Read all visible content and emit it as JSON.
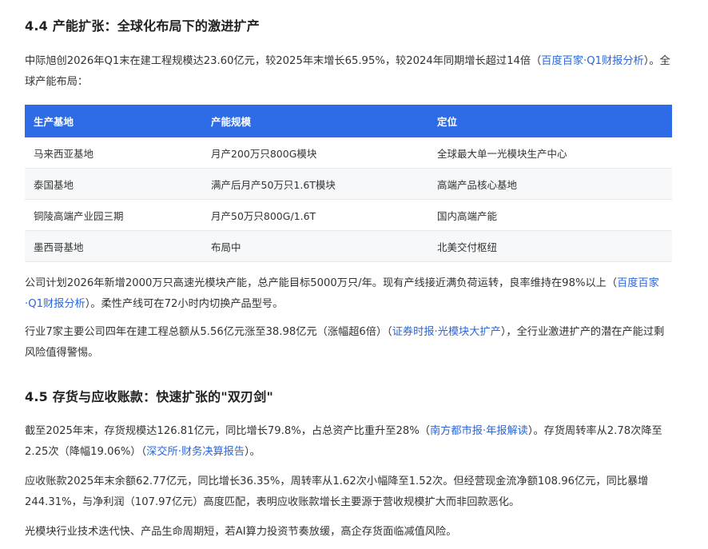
{
  "section_4_4": {
    "heading": "4.4 产能扩张：全球化布局下的激进扩产",
    "intro_text": "中际旭创2026年Q1末在建工程规模达23.60亿元，较2025年末增长65.95%，较2024年同期增长超过14倍（",
    "intro_cite": "百度百家·Q1财报分析",
    "intro_tail": "）。全球产能布局：",
    "table": {
      "headers": [
        "生产基地",
        "产能规模",
        "定位"
      ],
      "rows": [
        [
          "马来西亚基地",
          "月产200万只800G模块",
          "全球最大单一光模块生产中心"
        ],
        [
          "泰国基地",
          "满产后月产50万只1.6T模块",
          "高端产品核心基地"
        ],
        [
          "铜陵高端产业园三期",
          "月产50万只800G/1.6T",
          "国内高端产能"
        ],
        [
          "墨西哥基地",
          "布局中",
          "北美交付枢纽"
        ]
      ]
    },
    "p2_text": "公司计划2026年新增2000万只高速光模块产能，总产能目标5000万只/年。现有产线接近满负荷运转，良率维持在98%以上（",
    "p2_cite": "百度百家·Q1财报分析",
    "p2_tail": "）。柔性产线可在72小时内切换产品型号。",
    "p3_text": "行业7家主要公司四年在建工程总额从5.56亿元涨至38.98亿元（涨幅超6倍）（",
    "p3_cite": "证券时报·光模块大扩产",
    "p3_tail": "），全行业激进扩产的潜在产能过剩风险值得警惕。"
  },
  "section_4_5": {
    "heading": "4.5 存货与应收账款：快速扩张的\"双刃剑\"",
    "p4_text": "截至2025年末，存货规模达126.81亿元，同比增长79.8%，占总资产比重升至28%（",
    "p4_cite1": "南方都市报·年报解读",
    "p4_mid": "）。存货周转率从2.78次降至2.25次（降幅19.06%）（",
    "p4_cite2": "深交所·财务决算报告",
    "p4_tail": "）。",
    "p5_text": "应收账款2025年末余额62.77亿元，同比增长36.35%，周转率从1.62次小幅降至1.52次。但经营现金流净额108.96亿元，同比暴增244.31%，与净利润（107.97亿元）高度匹配，表明应收账款增长主要源于营收规模扩大而非回款恶化。",
    "p6_text": "光模块行业技术迭代快、产品生命周期短，若AI算力投资节奏放缓，高企存货面临减值风险。"
  },
  "colors": {
    "table_header_bg": "#2e6be6",
    "link": "#2b66d9",
    "row_stripe": "#f7f8fa"
  }
}
